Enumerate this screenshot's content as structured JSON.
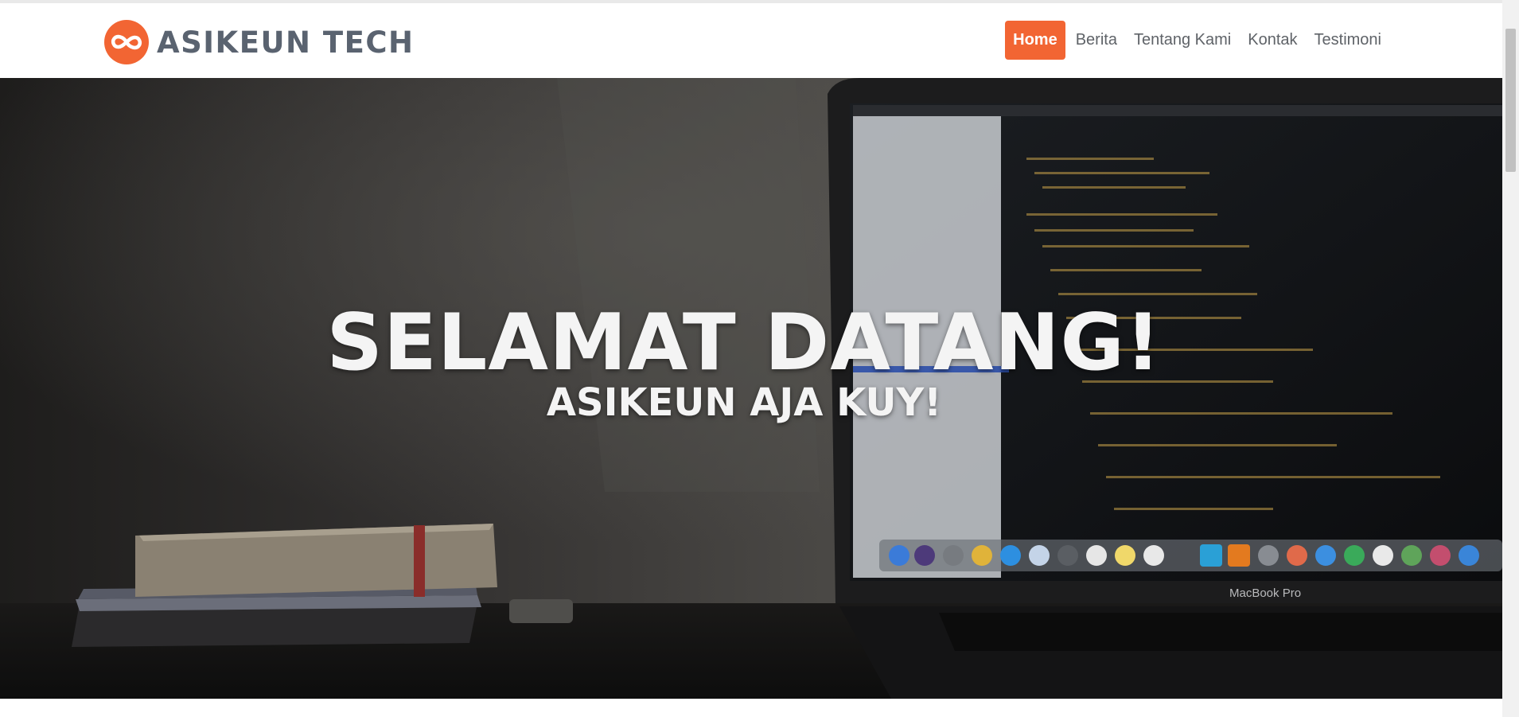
{
  "brand": {
    "name": "ASIKEUN TECH",
    "logo_icon": "infinity-logo-icon",
    "accent": "#f26533",
    "text_color": "#5a6370"
  },
  "nav": {
    "items": [
      {
        "label": "Home",
        "active": true
      },
      {
        "label": "Berita",
        "active": false
      },
      {
        "label": "Tentang Kami",
        "active": false
      },
      {
        "label": "Kontak",
        "active": false
      },
      {
        "label": "Testimoni",
        "active": false
      }
    ]
  },
  "hero": {
    "title": "SELAMAT DATANG!",
    "subtitle": "ASIKEUN AJA KUY!",
    "laptop_label": "MacBook Pro"
  }
}
